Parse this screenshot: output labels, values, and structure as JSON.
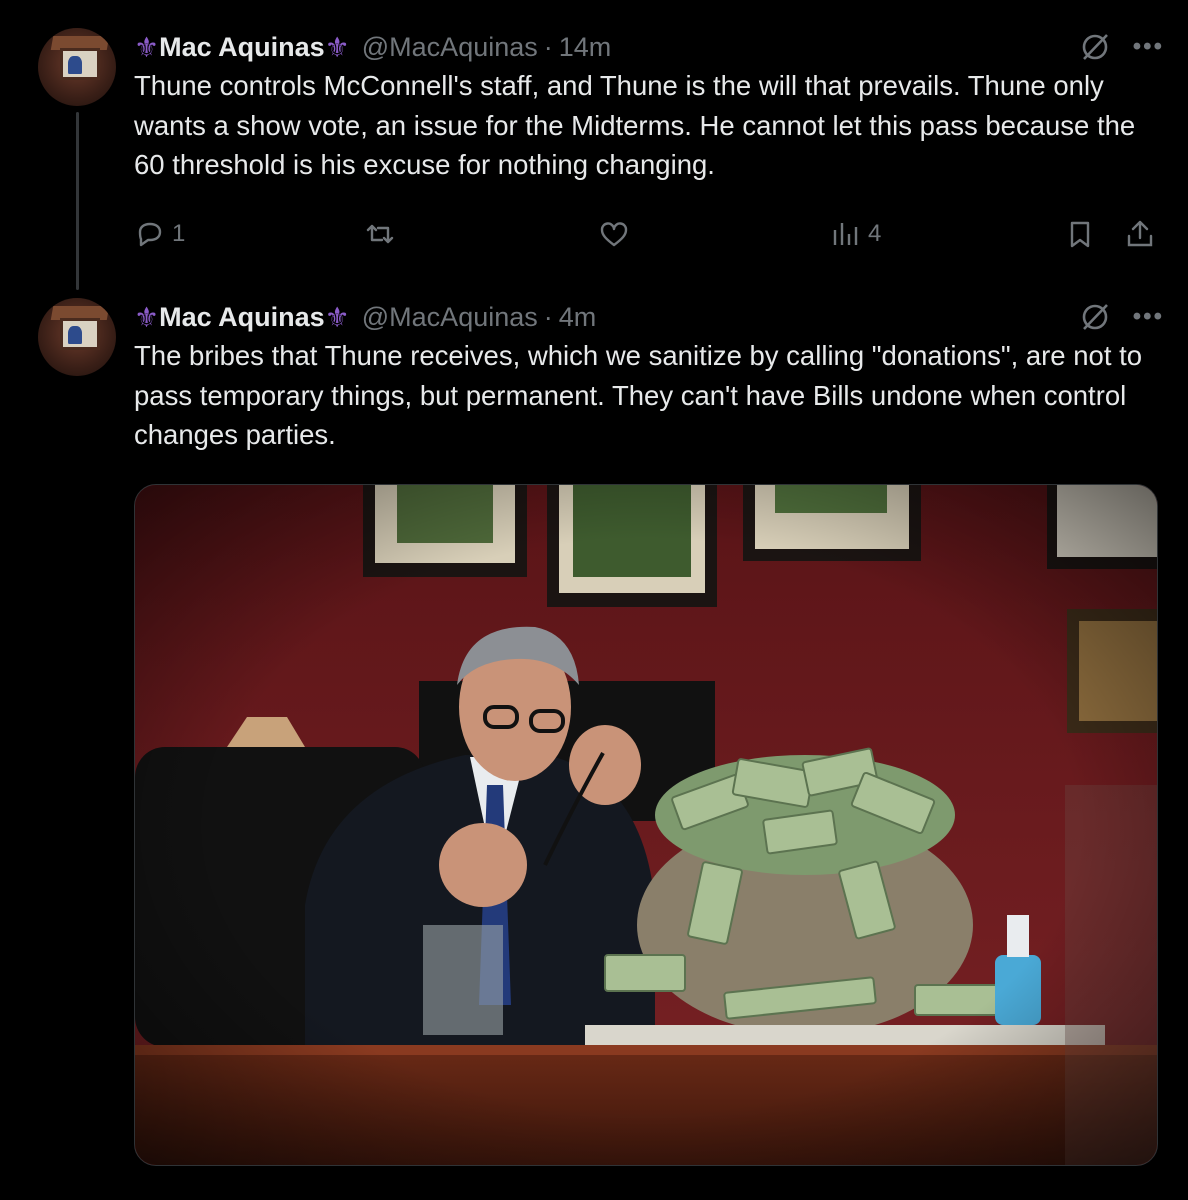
{
  "tweets": [
    {
      "display_name": "Mac Aquinas",
      "name_emoji": "⚜",
      "handle": "@MacAquinas",
      "time": "14m",
      "text": "Thune controls McConnell's staff, and Thune is the will that prevails. Thune only wants a show vote, an issue for the Midterms. He cannot let this pass because the 60 threshold is his excuse for nothing changing.",
      "replies": "1",
      "views": "4"
    },
    {
      "display_name": "Mac Aquinas",
      "name_emoji": "⚜",
      "handle": "@MacAquinas",
      "time": "4m",
      "text": "The bribes that Thune receives, which we sanitize by calling \"donations\", are not to pass temporary things, but permanent. They can't have Bills undone when control changes parties."
    }
  ],
  "separator": "·",
  "more_glyph": "•••",
  "colors": {
    "background": "#000000",
    "text": "#e7e9ea",
    "muted": "#71767b",
    "thread_line": "#333639",
    "emoji_purple": "#8b5cc9"
  },
  "icons": [
    "grok-icon",
    "more-icon",
    "reply-icon",
    "retweet-icon",
    "like-icon",
    "views-icon",
    "bookmark-icon",
    "share-icon"
  ]
}
